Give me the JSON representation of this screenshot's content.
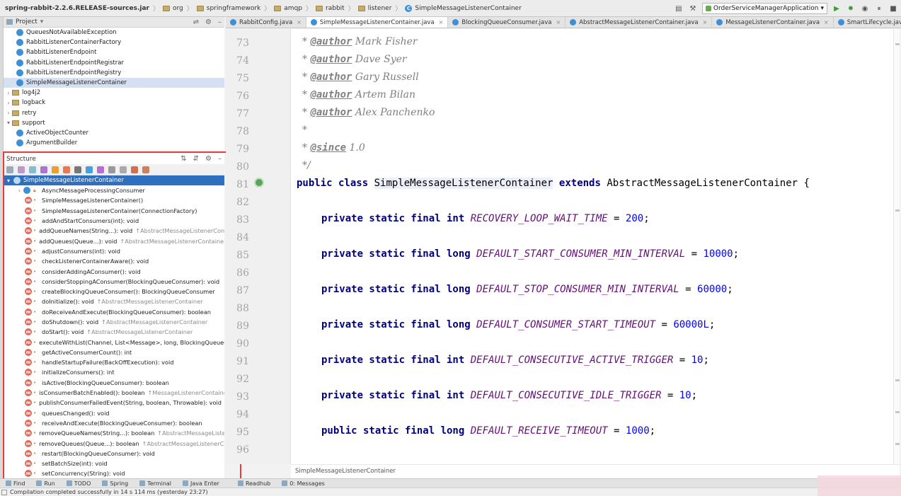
{
  "breadcrumbs": [
    {
      "label": "spring-rabbit-2.2.6.RELEASE-sources.jar",
      "kind": "jar"
    },
    {
      "label": "org",
      "kind": "folder"
    },
    {
      "label": "springframework",
      "kind": "folder"
    },
    {
      "label": "amqp",
      "kind": "folder"
    },
    {
      "label": "rabbit",
      "kind": "folder"
    },
    {
      "label": "listener",
      "kind": "folder"
    },
    {
      "label": "SimpleMessageListenerContainer",
      "kind": "class"
    }
  ],
  "run_config": "OrderServiceManagerApplication",
  "project_panel": {
    "title": "Project",
    "items": [
      {
        "label": "QueuesNotAvailableException",
        "type": "class",
        "depth": 2
      },
      {
        "label": "RabbitListenerContainerFactory",
        "type": "class",
        "depth": 2
      },
      {
        "label": "RabbitListenerEndpoint",
        "type": "class",
        "depth": 2
      },
      {
        "label": "RabbitListenerEndpointRegistrar",
        "type": "class",
        "depth": 2
      },
      {
        "label": "RabbitListenerEndpointRegistry",
        "type": "class",
        "depth": 2
      },
      {
        "label": "SimpleMessageListenerContainer",
        "type": "class",
        "depth": 2,
        "selected": true
      },
      {
        "label": "log4j2",
        "type": "package",
        "depth": 1
      },
      {
        "label": "logback",
        "type": "package",
        "depth": 1
      },
      {
        "label": "retry",
        "type": "package",
        "depth": 1
      },
      {
        "label": "support",
        "type": "package",
        "depth": 1,
        "expanded": true
      },
      {
        "label": "ActiveObjectCounter",
        "type": "class",
        "depth": 2
      },
      {
        "label": "ArgumentBuilder",
        "type": "class",
        "depth": 2
      }
    ]
  },
  "structure_panel": {
    "title": "Structure",
    "root": "SimpleMessageListenerContainer",
    "inner": "AsyncMessageProcessingConsumer",
    "members": [
      {
        "sig": "SimpleMessageListenerContainer()",
        "inh": ""
      },
      {
        "sig": "SimpleMessageListenerContainer(ConnectionFactory)",
        "inh": ""
      },
      {
        "sig": "addAndStartConsumers(int): void",
        "inh": ""
      },
      {
        "sig": "addQueueNames(String...): void",
        "inh": "↑AbstractMessageListenerContai"
      },
      {
        "sig": "addQueues(Queue...): void",
        "inh": "↑AbstractMessageListenerContainer"
      },
      {
        "sig": "adjustConsumers(int): void",
        "inh": ""
      },
      {
        "sig": "checkListenerContainerAware(): void",
        "inh": ""
      },
      {
        "sig": "considerAddingAConsumer(): void",
        "inh": ""
      },
      {
        "sig": "considerStoppingAConsumer(BlockingQueueConsumer): void",
        "inh": ""
      },
      {
        "sig": "createBlockingQueueConsumer(): BlockingQueueConsumer",
        "inh": ""
      },
      {
        "sig": "doInitialize(): void",
        "inh": "↑AbstractMessageListenerContainer"
      },
      {
        "sig": "doReceiveAndExecute(BlockingQueueConsumer): boolean",
        "inh": ""
      },
      {
        "sig": "doShutdown(): void",
        "inh": "↑AbstractMessageListenerContainer"
      },
      {
        "sig": "doStart(): void",
        "inh": "↑AbstractMessageListenerContainer"
      },
      {
        "sig": "executeWithList(Channel, List<Message>, long, BlockingQueueCo",
        "inh": ""
      },
      {
        "sig": "getActiveConsumerCount(): int",
        "inh": ""
      },
      {
        "sig": "handleStartupFailure(BackOffExecution): void",
        "inh": ""
      },
      {
        "sig": "initializeConsumers(): int",
        "inh": ""
      },
      {
        "sig": "isActive(BlockingQueueConsumer): boolean",
        "inh": ""
      },
      {
        "sig": "isConsumerBatchEnabled(): boolean",
        "inh": "↑MessageListenerContainer"
      },
      {
        "sig": "publishConsumerFailedEvent(String, boolean, Throwable): void",
        "inh": "↑A"
      },
      {
        "sig": "queuesChanged(): void",
        "inh": ""
      },
      {
        "sig": "receiveAndExecute(BlockingQueueConsumer): boolean",
        "inh": ""
      },
      {
        "sig": "removeQueueNames(String...): boolean",
        "inh": "↑AbstractMessageListene"
      },
      {
        "sig": "removeQueues(Queue...): boolean",
        "inh": "↑AbstractMessageListenerCont"
      },
      {
        "sig": "restart(BlockingQueueConsumer): void",
        "inh": ""
      },
      {
        "sig": "setBatchSize(int): void",
        "inh": ""
      },
      {
        "sig": "setConcurrency(String): void",
        "inh": ""
      }
    ]
  },
  "tabs": [
    {
      "label": "RabbitConfig.java",
      "active": false
    },
    {
      "label": "SimpleMessageListenerContainer.java",
      "active": true
    },
    {
      "label": "BlockingQueueConsumer.java",
      "active": false
    },
    {
      "label": "AbstractMessageListenerContainer.java",
      "active": false
    },
    {
      "label": "MessageListenerContainer.java",
      "active": false
    },
    {
      "label": "SmartLifecycle.java",
      "active": false
    }
  ],
  "code": {
    "author_tag": "@author",
    "since_tag": "@since",
    "authors": [
      "Mark Fisher",
      "Dave Syer",
      "Gary Russell",
      "Artem Bilan",
      "Alex Panchenko"
    ],
    "since": "1.0",
    "class_decl": {
      "kw1": "public class",
      "name": "SimpleMessageListenerContainer",
      "kw2": "extends",
      "parent": "AbstractMessageListenerContainer {"
    },
    "fields": [
      {
        "mods": "private static final int",
        "name": "RECOVERY_LOOP_WAIT_TIME",
        "value": "200"
      },
      {
        "mods": "private static final long",
        "name": "DEFAULT_START_CONSUMER_MIN_INTERVAL",
        "value": "10000"
      },
      {
        "mods": "private static final long",
        "name": "DEFAULT_STOP_CONSUMER_MIN_INTERVAL",
        "value": "60000"
      },
      {
        "mods": "private static final long",
        "name": "DEFAULT_CONSUMER_START_TIMEOUT",
        "value": "60000L"
      },
      {
        "mods": "private static final int",
        "name": "DEFAULT_CONSECUTIVE_ACTIVE_TRIGGER",
        "value": "10"
      },
      {
        "mods": "private static final int",
        "name": "DEFAULT_CONSECUTIVE_IDLE_TRIGGER",
        "value": "10"
      },
      {
        "mods": "public static final long",
        "name": "DEFAULT_RECEIVE_TIMEOUT",
        "value": "1000"
      }
    ],
    "line_numbers": [
      "73",
      "74",
      "75",
      "76",
      "77",
      "78",
      "79",
      "80",
      "81",
      "82",
      "83",
      "84",
      "85",
      "86",
      "87",
      "88",
      "89",
      "90",
      "91",
      "92",
      "93",
      "94",
      "95",
      "96"
    ]
  },
  "editor_breadcrumb": "SimpleMessageListenerContainer",
  "bottom_tools": [
    "Find",
    "Run",
    "TODO",
    "Spring",
    "Terminal",
    "Java Enter",
    "Readhub",
    "0: Messages"
  ],
  "status_text": "Compilation completed successfully in 14 s 114 ms (yesterday 23:27)",
  "colors": {
    "highlight_box": "#e53c3c",
    "selection": "#2f6fbf",
    "keyword": "#000080",
    "constant": "#660e7a",
    "number": "#0000ff"
  }
}
